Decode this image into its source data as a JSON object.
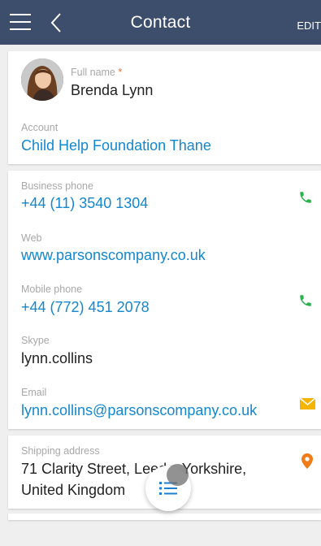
{
  "header": {
    "title": "Contact",
    "edit_label": "EDIT",
    "bg_color": "#3d4e6c"
  },
  "contact": {
    "full_name_label": "Full name",
    "required_mark": "*",
    "full_name": "Brenda Lynn",
    "account_label": "Account",
    "account": "Child Help Foundation Thane"
  },
  "communications": {
    "business_phone_label": "Business phone",
    "business_phone": "+44 (11) 3540 1304",
    "web_label": "Web",
    "web": "www.parsonscompany.co.uk",
    "mobile_phone_label": "Mobile phone",
    "mobile_phone": "+44 (772) 451 2078",
    "skype_label": "Skype",
    "skype": "lynn.collins",
    "email_label": "Email",
    "email": "lynn.collins@parsonscompany.co.uk"
  },
  "address": {
    "shipping_label": "Shipping address",
    "line1": "71 Clarity Street, Leeds, Yorkshire,",
    "line2": "United Kingdom"
  },
  "icons": {
    "menu": "hamburger-menu-icon",
    "back": "chevron-left-icon",
    "phone": "phone-icon",
    "email": "envelope-icon",
    "map": "map-pin-icon",
    "list": "list-icon"
  },
  "colors": {
    "link": "#1387cf",
    "phone_icon": "#2bb24c",
    "email_icon": "#f5b400",
    "map_icon": "#f07d1a",
    "required": "#e96a37",
    "fab_icon": "#1d7fd1"
  }
}
